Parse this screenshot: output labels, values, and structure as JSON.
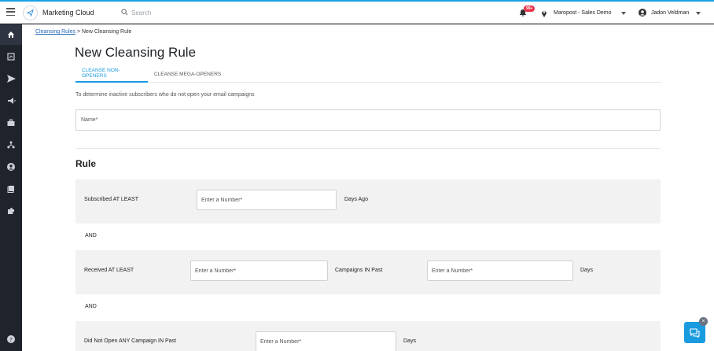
{
  "header": {
    "brand": "Marketing Cloud",
    "search_placeholder": "Search",
    "notification_count": "99+",
    "account": "Maropost - Sales Demo",
    "user": "Jadon Veldman"
  },
  "sidebar": {
    "items": [
      {
        "icon": "home-icon",
        "active": true
      },
      {
        "icon": "reports-icon"
      },
      {
        "icon": "send-icon"
      },
      {
        "icon": "megaphone-icon"
      },
      {
        "icon": "briefcase-icon"
      },
      {
        "icon": "workflow-icon"
      },
      {
        "icon": "contacts-icon"
      },
      {
        "icon": "content-icon"
      },
      {
        "icon": "puzzle-icon"
      },
      {
        "icon": "help-icon"
      }
    ]
  },
  "breadcrumb": {
    "link": "Cleansing Rules",
    "separator": ">",
    "current": "New Cleansing Rule"
  },
  "page": {
    "title": "New Cleansing Rule",
    "tabs": [
      {
        "label": "CLEANSE NON-OPENERS",
        "active": true
      },
      {
        "label": "CLEANSE MEGA-OPENERS",
        "active": false
      }
    ],
    "description": "To determine inactive subscribers who do not open your email campaigns",
    "name_placeholder": "Name*",
    "rule_title": "Rule",
    "connector": "AND",
    "rules": [
      {
        "label": "Subscribed AT LEAST",
        "input_placeholder": "Enter a Number*",
        "suffix": "Days Ago"
      },
      {
        "label": "Received AT LEAST",
        "input_placeholder": "Enter a Number*",
        "middle": "Campaigns IN Past",
        "input2_placeholder": "Enter a Number*",
        "suffix": "Days"
      },
      {
        "label": "Did Not Open ANY Campaign IN Past",
        "input_placeholder": "Enter a Number*",
        "suffix": "Days"
      }
    ]
  },
  "colors": {
    "accent": "#1a9be0",
    "sidebar_bg": "#1f232b",
    "badge": "#e8334a"
  }
}
